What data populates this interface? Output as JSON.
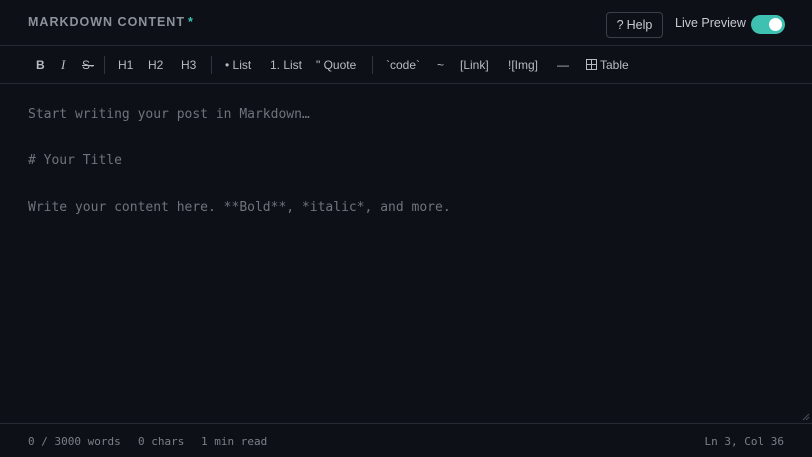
{
  "header": {
    "title": "MARKDOWN CONTENT",
    "required_mark": "*",
    "help_icon": "?",
    "help_label": "Help",
    "live_preview_label": "Live Preview",
    "live_preview_enabled": true
  },
  "toolbar": {
    "bold": "B",
    "italic": "I",
    "strikethrough": "S-",
    "h1": "H1",
    "h2": "H2",
    "h3": "H3",
    "bullet_list": "• List",
    "numbered_list": "1. List",
    "quote": "\" Quote",
    "code": "`code`",
    "code_block": "~",
    "link": "[Link]",
    "image": "![Img]",
    "hr": "—",
    "table_icon": "grid-icon",
    "table": "Table"
  },
  "editor": {
    "lines": [
      "Start writing your post in Markdown…",
      "# Your Title",
      "Write your content here. **Bold**, *italic*, and more."
    ]
  },
  "status": {
    "words": "0 / 3000 words",
    "chars": "0 chars",
    "read_time": "1 min read",
    "cursor": "Ln 3, Col 36"
  },
  "colors": {
    "accent": "#3fc1b1",
    "background": "#0d1016",
    "border": "#262b33"
  }
}
